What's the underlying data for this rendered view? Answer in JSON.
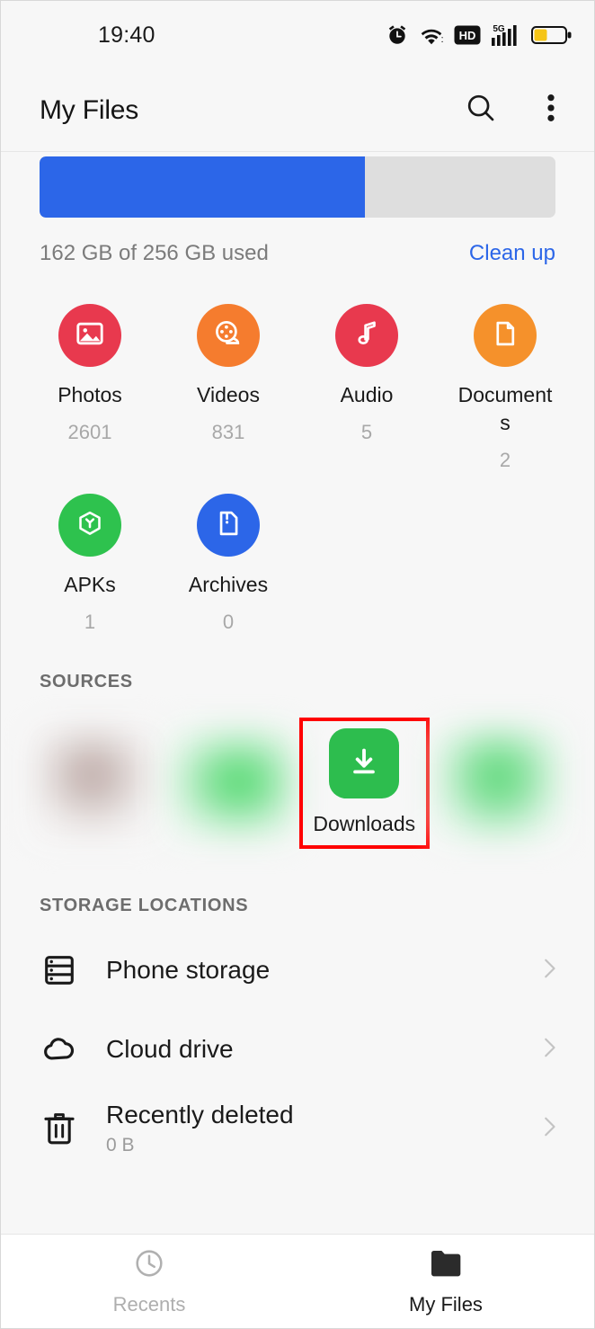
{
  "statusbar": {
    "time": "19:40",
    "icons": [
      "alarm-icon",
      "wifi-icon",
      "hd-icon",
      "5g-signal-icon",
      "battery-icon"
    ],
    "network_label": "5G",
    "hd_label": "HD",
    "battery_level_percent": 40,
    "battery_color": "#f5c518"
  },
  "appbar": {
    "title": "My Files",
    "search_label": "Search",
    "more_label": "More options"
  },
  "storage": {
    "used_percent": 63,
    "summary": "162 GB of 256 GB used",
    "clean_up_label": "Clean up",
    "fill_color": "#2c66e8",
    "track_color": "#dedede"
  },
  "categories": [
    {
      "label": "Photos",
      "count": "2601",
      "icon": "image-icon",
      "color": "#e8394e"
    },
    {
      "label": "Videos",
      "count": "831",
      "icon": "film-reel-icon",
      "color": "#f57c2e"
    },
    {
      "label": "Audio",
      "count": "5",
      "icon": "music-note-icon",
      "color": "#e8394e"
    },
    {
      "label": "Documents",
      "count": "2",
      "icon": "document-icon",
      "color": "#f5912b"
    },
    {
      "label": "APKs",
      "count": "1",
      "icon": "package-icon",
      "color": "#2ec24e"
    },
    {
      "label": "Archives",
      "count": "0",
      "icon": "archive-icon",
      "color": "#2c66e8"
    }
  ],
  "sources": {
    "title": "SOURCES",
    "items": [
      {
        "label": "",
        "redacted": true,
        "blur": "a"
      },
      {
        "label": "",
        "redacted": true,
        "blur": "b"
      },
      {
        "label": "Downloads",
        "redacted": false,
        "icon": "download-icon",
        "color": "#2dbd4e",
        "highlighted": true
      },
      {
        "label": "",
        "redacted": true,
        "blur": "c"
      }
    ],
    "highlight_color": "#ff0000"
  },
  "storage_locations": {
    "title": "STORAGE LOCATIONS",
    "items": [
      {
        "title": "Phone storage",
        "subtitle": "",
        "icon": "drive-icon"
      },
      {
        "title": "Cloud drive",
        "subtitle": "",
        "icon": "cloud-icon"
      },
      {
        "title": "Recently deleted",
        "subtitle": "0 B",
        "icon": "trash-icon"
      }
    ]
  },
  "bottom_nav": {
    "items": [
      {
        "label": "Recents",
        "icon": "clock-icon",
        "active": false
      },
      {
        "label": "My Files",
        "icon": "folder-icon",
        "active": true
      }
    ]
  }
}
